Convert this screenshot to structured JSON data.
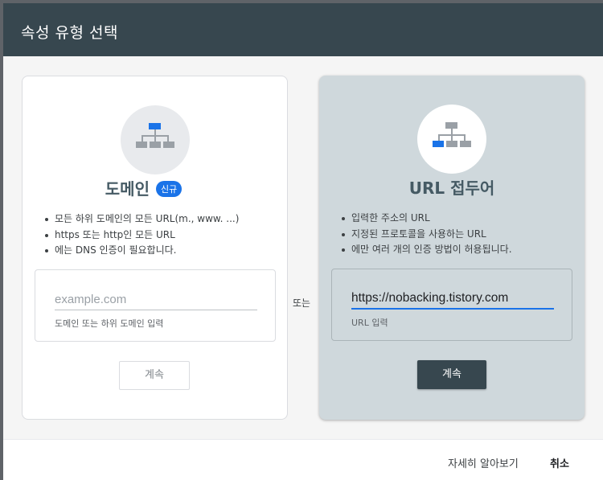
{
  "dialog": {
    "title": "속성 유형 선택",
    "or_label": "또는"
  },
  "domain_card": {
    "title": "도메인",
    "badge": "신규",
    "bullets": [
      "모든 하위 도메인의 모든 URL(m., www. ...)",
      "https 또는 http인 모든 URL",
      "에는 DNS 인증이 필요합니다."
    ],
    "input_placeholder": "example.com",
    "input_value": "",
    "helper": "도메인 또는 하위 도메인 입력",
    "continue_label": "계속",
    "icon": "sitemap-icon"
  },
  "url_card": {
    "title": "URL 접두어",
    "bullets": [
      "입력한 주소의 URL",
      "지정된 프로토콜을 사용하는 URL",
      "에만 여러 개의 인증 방법이 허용됩니다."
    ],
    "input_value": "https://nobacking.tistory.com",
    "helper": "URL 입력",
    "continue_label": "계속",
    "icon": "sitemap-icon"
  },
  "footer": {
    "learn_more": "자세히 알아보기",
    "cancel": "취소"
  },
  "colors": {
    "header_bg": "#37474f",
    "accent_blue": "#1a73e8",
    "selected_card_bg": "#cfd8dc"
  }
}
